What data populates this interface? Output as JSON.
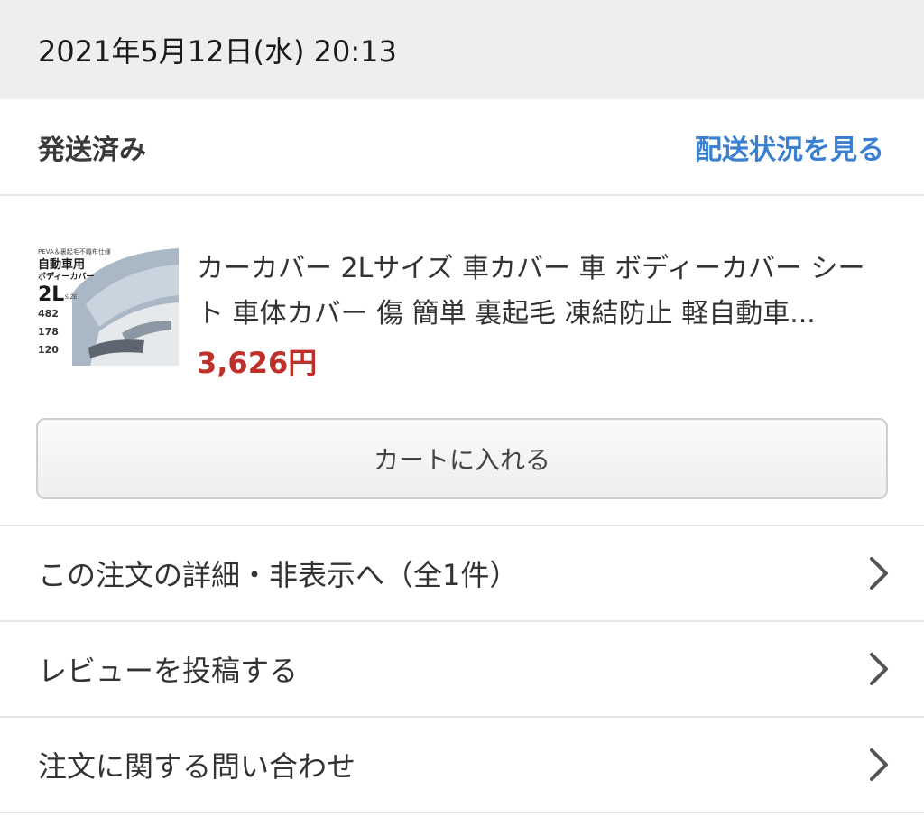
{
  "order": {
    "date": "2021年5月12日(水) 20:13",
    "status": "発送済み",
    "tracking_link": "配送状況を見る"
  },
  "product": {
    "title": "カーカバー 2Lサイズ 車カバー 車 ボディーカバー シート 車体カバー 傷 簡単 裏起毛 凍結防止 軽自動車...",
    "price": "3,626円",
    "image_alt": "car-cover-product-photo",
    "image_text": {
      "badge": "PEVA＆裏起毛不織布仕様",
      "line1": "自動車用",
      "line2": "ボディーカバー",
      "size": "2L",
      "size_sub": "SIZE",
      "dim1": "482",
      "dim2": "178",
      "dim3": "120"
    }
  },
  "actions": {
    "add_to_cart": "カートに入れる"
  },
  "menu": {
    "items": [
      {
        "label": "この注文の詳細・非表示へ（全1件）",
        "icon": "chevron-right-icon"
      },
      {
        "label": "レビューを投稿する",
        "icon": "chevron-right-icon"
      },
      {
        "label": "注文に関する問い合わせ",
        "icon": "chevron-right-icon"
      }
    ]
  },
  "colors": {
    "link": "#3b7fd1",
    "price": "#c0302a",
    "header_bg": "#eeeeee"
  }
}
